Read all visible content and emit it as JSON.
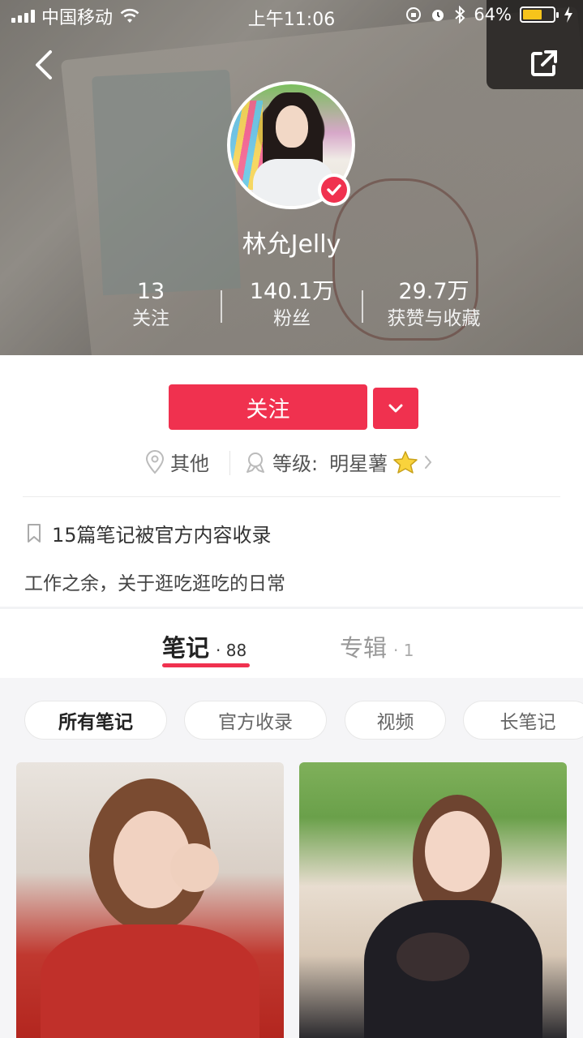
{
  "status_bar": {
    "carrier": "中国移动",
    "time": "上午11:06",
    "battery_percent": "64%",
    "battery_level": 0.64,
    "battery_color": "#f7c41b"
  },
  "header": {
    "back_icon": "chevron-left-icon",
    "share_icon": "external-share-icon"
  },
  "profile": {
    "username": "林允Jelly",
    "verified": true,
    "stats": [
      {
        "value": "13",
        "label": "关注"
      },
      {
        "value": "140.1万",
        "label": "粉丝"
      },
      {
        "value": "29.7万",
        "label": "获赞与收藏"
      }
    ]
  },
  "actions": {
    "follow_label": "关注",
    "accent_color": "#f0314f"
  },
  "meta": {
    "location": "其他",
    "level_label": "等级:",
    "level_value": "明星薯"
  },
  "collected_text": "15篇笔记被官方内容收录",
  "bio": "工作之余，关于逛吃逛吃的日常",
  "tabs": [
    {
      "title": "笔记",
      "count": "· 88",
      "active": true
    },
    {
      "title": "专辑",
      "count": "· 1",
      "active": false
    }
  ],
  "filters": [
    "所有笔记",
    "官方收录",
    "视频",
    "长笔记"
  ]
}
